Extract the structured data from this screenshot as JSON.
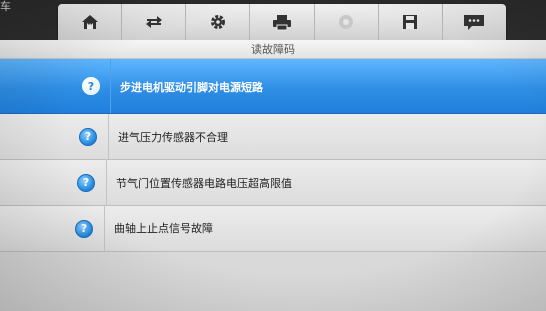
{
  "corner_text": "车",
  "toolbar": {
    "buttons": [
      {
        "icon": "home-icon"
      },
      {
        "icon": "vehicle-swap-icon"
      },
      {
        "icon": "gear-icon"
      },
      {
        "icon": "printer-icon"
      },
      {
        "icon": "help-disabled-icon"
      },
      {
        "icon": "save-icon"
      },
      {
        "icon": "message-icon"
      }
    ]
  },
  "page": {
    "title": "读故障码"
  },
  "fault_codes": {
    "items": [
      {
        "label": "步进电机驱动引脚对电源短路",
        "selected": true
      },
      {
        "label": "进气压力传感器不合理",
        "selected": false
      },
      {
        "label": "节气门位置传感器电路电压超高限值",
        "selected": false
      },
      {
        "label": "曲轴上止点信号故障",
        "selected": false
      }
    ],
    "help_glyph": "?"
  },
  "colors": {
    "selected_row": "#2f8fe6",
    "row": "#e4e4e4",
    "toolbar": "#e0e0e0",
    "icon": "#333333"
  }
}
